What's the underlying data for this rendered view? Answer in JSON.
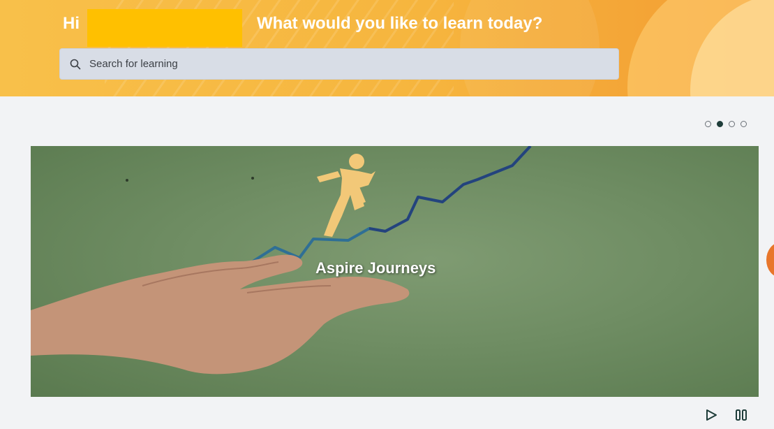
{
  "header": {
    "greeting": "Hi",
    "question": "What would you like to learn today?"
  },
  "search": {
    "placeholder": "Search for learning",
    "icon": "search-icon"
  },
  "carousel": {
    "slide_count": 4,
    "active_index": 1,
    "slide_title": "Aspire Journeys",
    "controls": {
      "play_icon": "play-icon",
      "pause_icon": "pause-icon"
    }
  },
  "colors": {
    "banner_start": "#f8c04a",
    "banner_end": "#f39b32",
    "accent_orange": "#e8762b",
    "active_dot": "#1f3d3a",
    "hero_green": "#6f8d63"
  }
}
